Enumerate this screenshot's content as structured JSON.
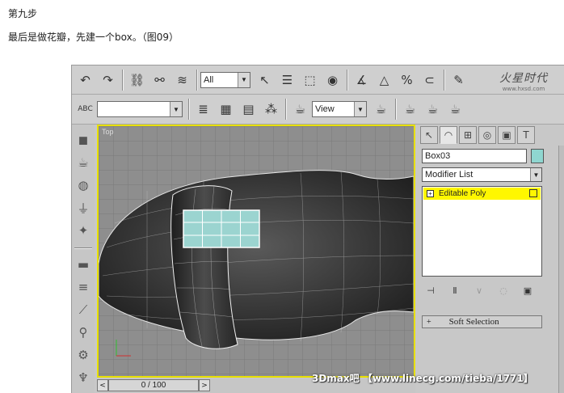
{
  "article": {
    "step_title": "第九步",
    "step_desc": "最后是做花瓣，先建一个box。（图09）"
  },
  "toolbar_main": {
    "selection_filter": "All",
    "icons": [
      "undo-icon",
      "redo-icon",
      "link-icon",
      "unlink-icon",
      "bind-space-warp-icon",
      "select-icon",
      "select-by-name-icon",
      "rect-region-icon",
      "window-crossing-icon",
      "angle-snap-icon",
      "mirror-icon",
      "percent-snap-icon",
      "spinner-snap-icon",
      "named-selection-icon"
    ]
  },
  "toolbar_second": {
    "named_selection_value": "",
    "view_dropdown": "View",
    "icons": [
      "abc-icon",
      "layers-icon",
      "track-view-icon",
      "schematic-icon",
      "material-editor-icon",
      "render-scene-icon",
      "quick-render-icon",
      "render-type-icon"
    ]
  },
  "logo": {
    "main": "火星时代",
    "sub": "www.hxsd.com"
  },
  "viewport": {
    "label": "Top",
    "border_color": "#e8e000"
  },
  "timeline": {
    "frame_display": "0 / 100",
    "prev": "<",
    "next": ">"
  },
  "command_panel": {
    "object_name": "Box03",
    "object_color": "#8fd6d0",
    "modifier_list": "Modifier List",
    "stack_item": "Editable Poly",
    "rollout_soft_selection": "Soft Selection",
    "rollout_plus": "+"
  },
  "watermark": "3Dmax吧 【www.linecg.com/tieba/1771】"
}
